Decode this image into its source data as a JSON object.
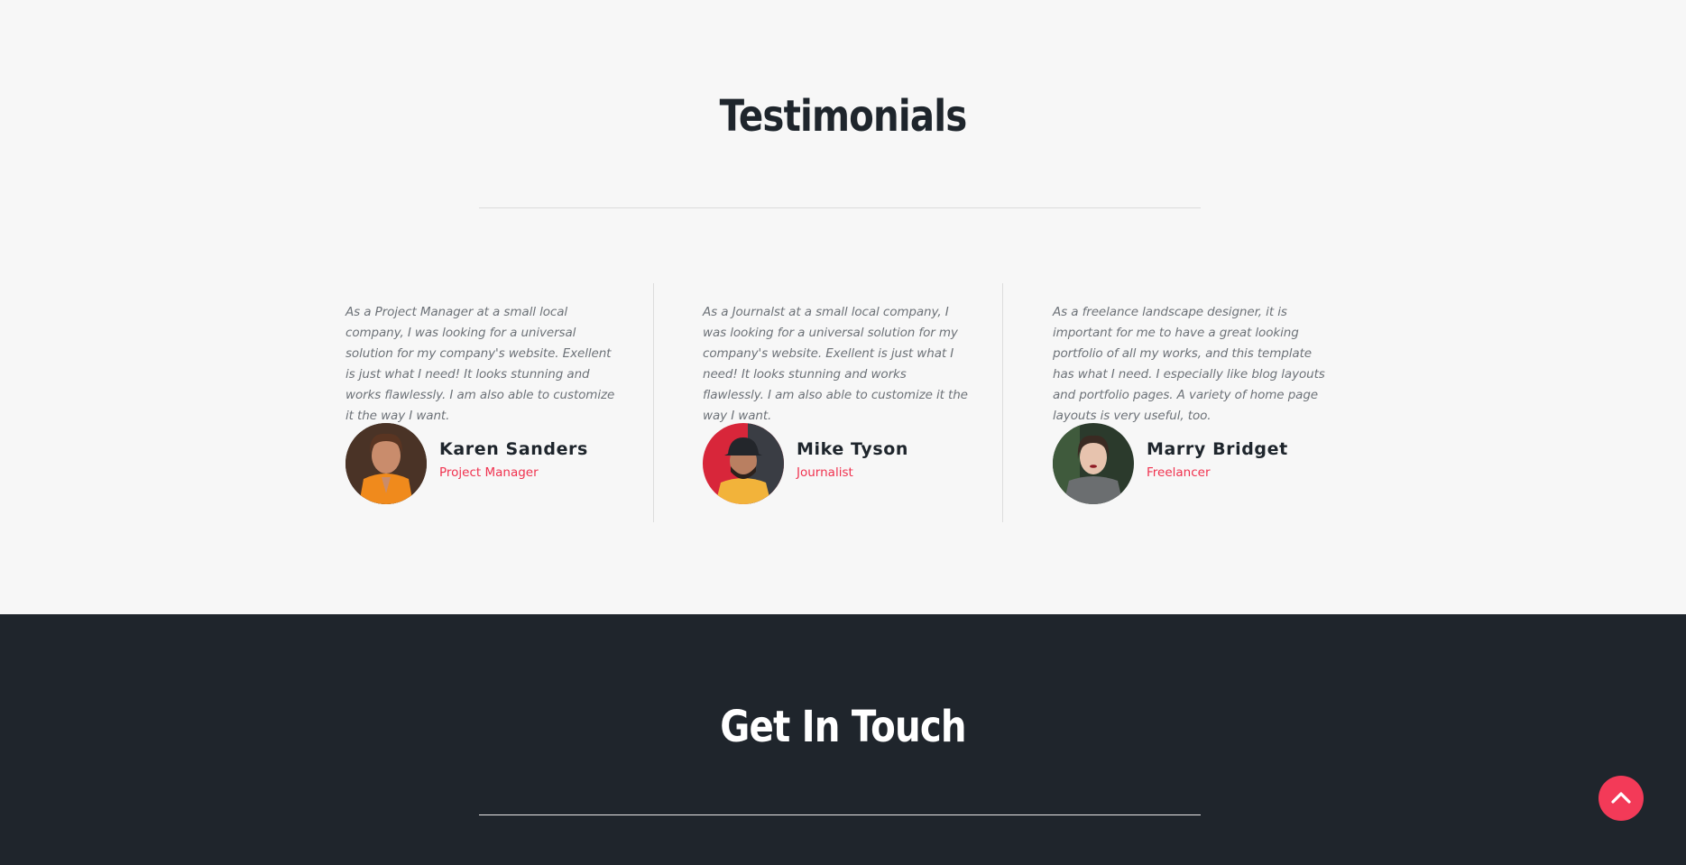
{
  "testimonials": {
    "title": "Testimonials",
    "items": [
      {
        "quote": "As a Project Manager at a small local company, I was looking for a universal solution for my company's website. Exellent is just what I need! It looks stunning and works flawlessly. I am also able to customize it the way I want.",
        "name": "Karen Sanders",
        "role": "Project Manager"
      },
      {
        "quote": "As a Journalst at a small local company, I was looking for a universal solution for my company's website. Exellent is just what I need! It looks stunning and works flawlessly. I am also able to customize it the way I want.",
        "name": "Mike Tyson",
        "role": "Journalist"
      },
      {
        "quote": "As a freelance landscape designer, it is important for me to have a great looking portfolio of all my works, and this template has what I need. I especially like blog layouts and portfolio pages. A variety of home page layouts is very useful, too.",
        "name": "Marry Bridget",
        "role": "Freelancer"
      }
    ]
  },
  "contact": {
    "title": "Get In Touch"
  },
  "colors": {
    "accent": "#f0324f",
    "dark": "#1f252c",
    "light_bg": "#f7f7f7"
  },
  "icons": {
    "back_to_top": "chevron-up-icon"
  }
}
